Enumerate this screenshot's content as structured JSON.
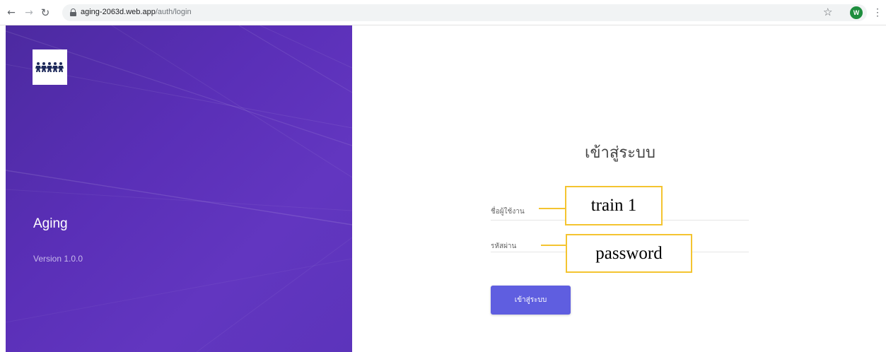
{
  "browser": {
    "back_icon": "arrow-left-icon",
    "forward_icon": "arrow-right-icon",
    "reload_icon": "reload-icon",
    "url_host": "aging-2063d.web.app",
    "url_path": "/auth/login",
    "bookmark_icon": "star-icon",
    "profile_initial": "W",
    "menu_icon": "vertical-dots-icon"
  },
  "brand": {
    "app_name": "Aging",
    "version": "Version 1.0.0"
  },
  "login": {
    "title": "เข้าสู่ระบบ",
    "username_label": "ชื่อผู้ใช้งาน",
    "password_label": "รหัสผ่าน",
    "submit_label": "เข้าสู่ระบบ"
  },
  "annotations": {
    "username_hint": "train 1",
    "password_hint": "password"
  },
  "colors": {
    "panel_purple": "#5a2fb7",
    "button_blue": "#5f5ee0",
    "callout_yellow": "#f4c430",
    "profile_green": "#1e8e3e"
  }
}
